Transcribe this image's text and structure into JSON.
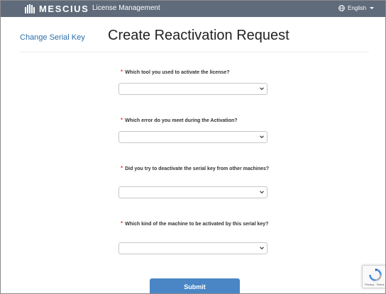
{
  "header": {
    "brand": "MESCIUS",
    "nav_link": "License Management",
    "language": "English"
  },
  "sidebar": {
    "link": "Change Serial Key"
  },
  "page": {
    "title": "Create Reactivation Request"
  },
  "form": {
    "questions": [
      {
        "label": "Which tool you used to activate the license?",
        "value": ""
      },
      {
        "label": "Which error do you meet during the Activation?",
        "value": ""
      },
      {
        "label": "Did you try to deactivate the serial key from other machines?",
        "value": ""
      },
      {
        "label": "Which kind of the machine to be activated by this serial key?",
        "value": ""
      }
    ],
    "required_mark": "*",
    "submit_label": "Submit"
  },
  "recaptcha": {
    "text": "Privacy - Terms"
  },
  "colors": {
    "topbar": "#5f6b7a",
    "link": "#2b6ea8",
    "submit": "#4a86c5",
    "required": "#d9534f"
  }
}
